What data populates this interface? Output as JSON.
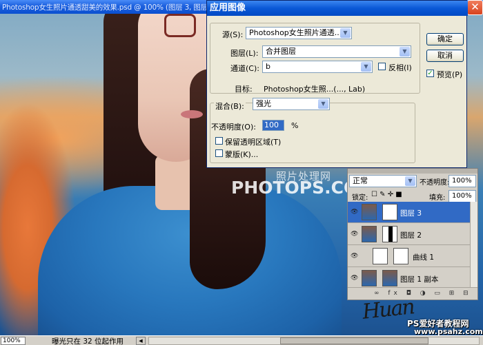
{
  "window": {
    "title": "Photoshop女生照片通透甜美的效果.psd @ 100% (图层 3, 图层蒙",
    "close_glyph": "✕"
  },
  "dialog": {
    "title": "应用图像",
    "source_label": "源(S):",
    "source_value": "Photoshop女生照片通透...",
    "layer_label": "图层(L):",
    "layer_value": "合并图层",
    "channel_label": "通道(C):",
    "channel_value": "b",
    "invert_label": "反相(I)",
    "invert_checked": false,
    "target_label": "目标:",
    "target_value": "Photoshop女生照...(..., Lab)",
    "blending_label": "混合(B):",
    "blending_value": "强光",
    "opacity_label": "不透明度(O):",
    "opacity_value": "100",
    "opacity_unit": "%",
    "preserve_transparency_label": "保留透明区域(T)",
    "preserve_transparency_checked": false,
    "mask_label": "蒙版(K)...",
    "mask_checked": false,
    "ok_label": "确定",
    "cancel_label": "取消",
    "preview_label": "预览(P)",
    "preview_checked": true
  },
  "watermark": {
    "chinese": "照片处理网",
    "english": "PHOTOPS.COM"
  },
  "layers_panel": {
    "blend_mode": "正常",
    "opacity_label": "不透明度:",
    "opacity_value": "100%",
    "lock_label": "锁定:",
    "fill_label": "填充:",
    "fill_value": "100%",
    "layers": [
      {
        "name": "图层 3",
        "selected": true
      },
      {
        "name": "图层 2",
        "selected": false
      },
      {
        "name": "曲线 1",
        "selected": false
      },
      {
        "name": "图层 1 副本",
        "selected": false
      }
    ],
    "toolbar_glyphs": "∞ fx ◘ ◑ ▭ ⊞ ⊟"
  },
  "statusbar": {
    "zoom": "100%",
    "message": "曝光只在 32 位起作用"
  },
  "credits": {
    "signature": "Huan",
    "site_name": "PS爱好者教程网",
    "site_url": "www.psahz.com"
  },
  "colors": {
    "title_blue": "#0a58d6",
    "selection_blue": "#316ac5",
    "dialog_bg": "#ece9d8"
  }
}
